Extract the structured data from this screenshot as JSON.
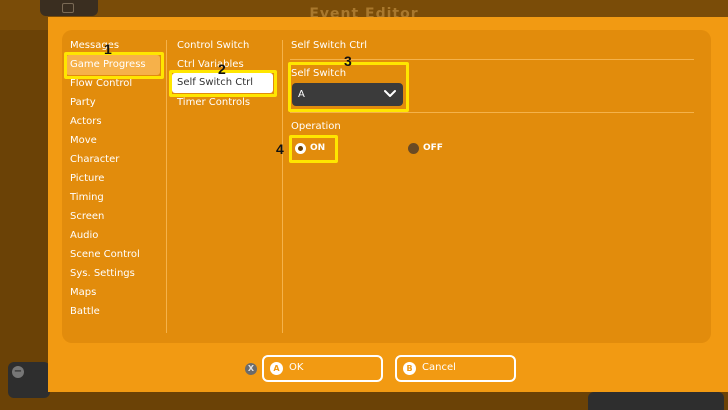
{
  "window": {
    "title": "Event Editor"
  },
  "categories": [
    "Messages",
    "Game Progress",
    "Flow Control",
    "Party",
    "Actors",
    "Move",
    "Character",
    "Picture",
    "Timing",
    "Screen",
    "Audio",
    "Scene Control",
    "Sys. Settings",
    "Maps",
    "Battle"
  ],
  "selected_category": "Game Progress",
  "subcommands": [
    "Control Switch",
    "Ctrl Variables",
    "Self Switch Ctrl",
    "Timer Controls"
  ],
  "selected_subcommand": "Self Switch Ctrl",
  "detail": {
    "heading": "Self Switch Ctrl",
    "self_switch_label": "Self Switch",
    "self_switch_value": "A",
    "operation_label": "Operation",
    "option_on": "ON",
    "option_off": "OFF",
    "selected_option": "ON"
  },
  "footer": {
    "close_key": "X",
    "ok_key": "A",
    "ok_label": "OK",
    "cancel_key": "B",
    "cancel_label": "Cancel"
  },
  "annotations": {
    "a1": "1",
    "a2": "2",
    "a3": "3",
    "a4": "4",
    "color": "#ffe600"
  },
  "colors": {
    "dialog": "#f29a12",
    "panel": "#e28c0c",
    "dropdown": "#3b3b3b"
  },
  "icons": {
    "dropdown": "chevron-down-icon"
  }
}
